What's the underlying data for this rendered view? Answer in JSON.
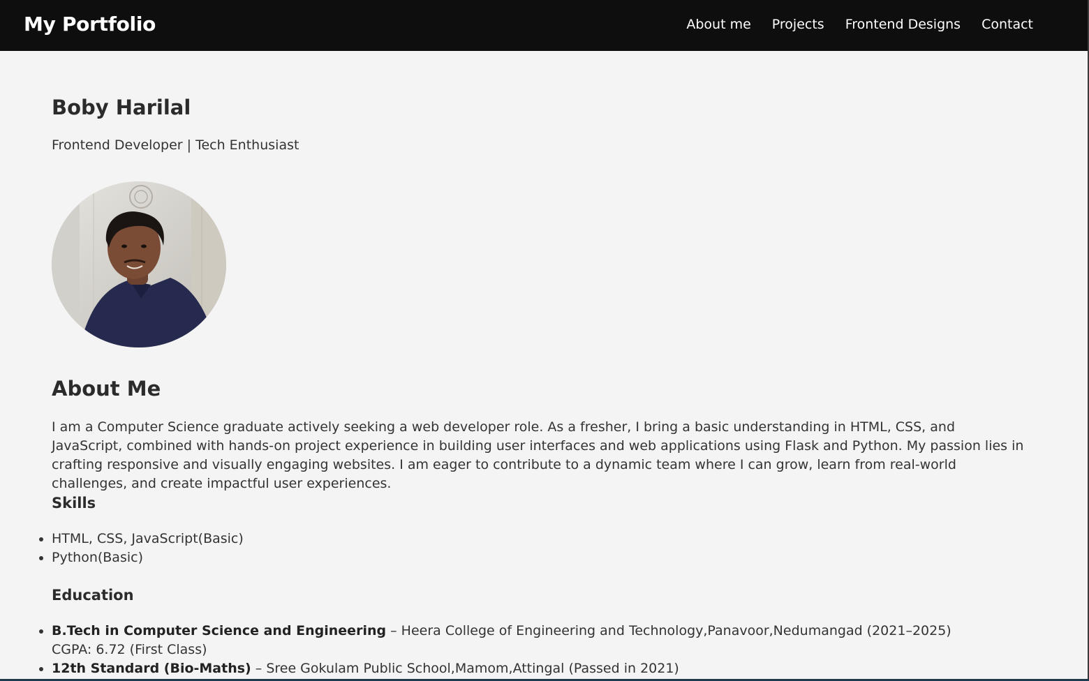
{
  "navbar": {
    "brand": "My Portfolio",
    "links": [
      "About me",
      "Projects",
      "Frontend Designs",
      "Contact"
    ]
  },
  "hero": {
    "name": "Boby Harilal",
    "tagline": "Frontend Developer | Tech Enthusiast"
  },
  "about": {
    "title": "About Me",
    "text": "I am a Computer Science graduate actively seeking a web developer role. As a fresher, I bring a basic understanding in HTML, CSS, and JavaScript, combined with hands-on project experience in building user interfaces and web applications using Flask and Python. My passion lies in crafting responsive and visually engaging websites. I am eager to contribute to a dynamic team where I can grow, learn from real-world challenges, and create impactful user experiences."
  },
  "skills": {
    "title": "Skills",
    "items": [
      "HTML, CSS, JavaScript(Basic)",
      "Python(Basic)"
    ]
  },
  "education": {
    "title": "Education",
    "items": [
      {
        "degree": "B.Tech in Computer Science and Engineering",
        "detail": " – Heera College of Engineering and Technology,Panavoor,Nedumangad (2021–2025)",
        "extra": "CGPA: 6.72 (First Class)"
      },
      {
        "degree": "12th Standard (Bio-Maths)",
        "detail": " – Sree Gokulam Public School,Mamom,Attingal (Passed in 2021)",
        "extra": ""
      }
    ]
  }
}
